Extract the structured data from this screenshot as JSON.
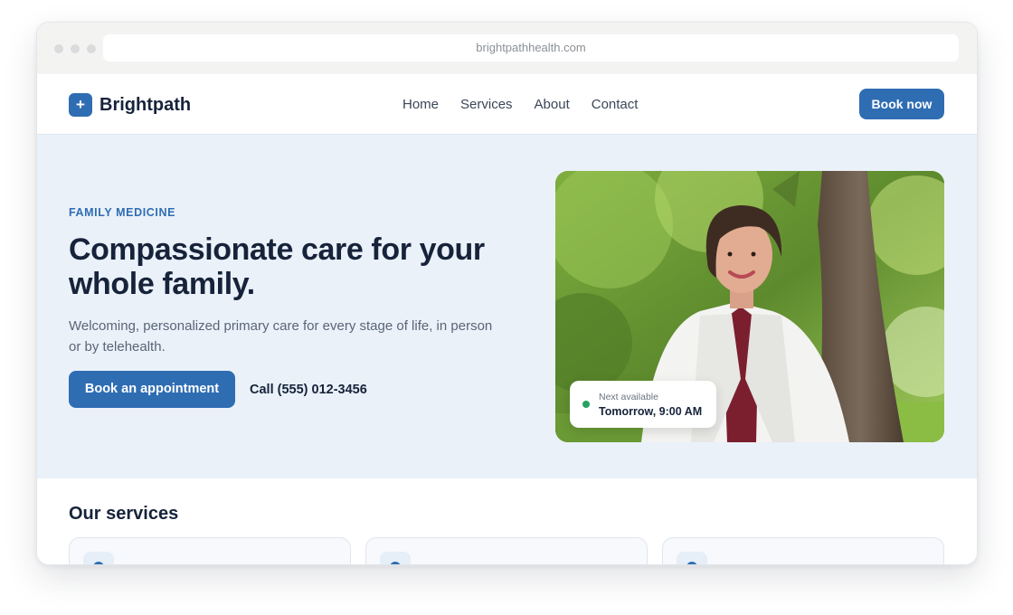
{
  "browser": {
    "url": "brightpathhealth.com"
  },
  "nav": {
    "logo_text": "Brightpath",
    "logo_glyph": "+",
    "links": [
      {
        "label": "Home"
      },
      {
        "label": "Services"
      },
      {
        "label": "About"
      },
      {
        "label": "Contact"
      }
    ],
    "cta_label": "Book now"
  },
  "hero": {
    "eyebrow": "FAMILY MEDICINE",
    "headline": "Compassionate care for your whole family.",
    "subtitle": "Welcoming, personalized primary care for every stage of life, in person or by telehealth.",
    "primary_cta": "Book an appointment",
    "phone_link": "Call (555) 012-3456",
    "availability": {
      "label": "Next available",
      "time": "Tomorrow, 9:00 AM",
      "status_color": "#27a164"
    }
  },
  "services": {
    "title": "Our services",
    "cards": [
      {
        "icon": "service-icon"
      },
      {
        "icon": "service-icon"
      },
      {
        "icon": "service-icon"
      }
    ]
  },
  "colors": {
    "brand": "#2f6db3",
    "heading": "#16233a",
    "hero_background": "#eaf1f9"
  }
}
